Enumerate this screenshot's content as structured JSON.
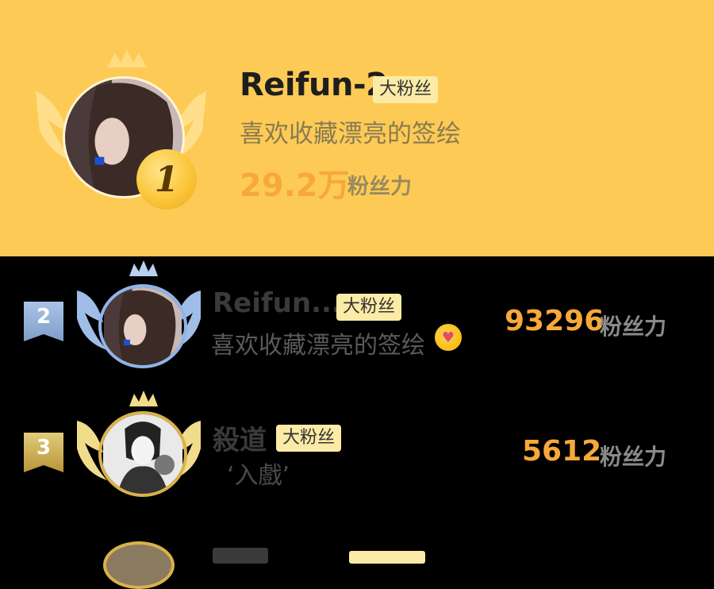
{
  "top_entry": {
    "rank": "1",
    "name": "Reifun-2",
    "badge": "大粉丝",
    "bio": "喜欢收藏漂亮的签绘",
    "score": "29.2万",
    "score_label": "粉丝力"
  },
  "entries": [
    {
      "rank": "2",
      "name": "Reifun...",
      "badge": "大粉丝",
      "bio": "喜欢收藏漂亮的签绘",
      "bio_emoji_icon": "hugging-face-icon",
      "score": "93296",
      "score_label": "粉丝力"
    },
    {
      "rank": "3",
      "name": "殺道",
      "badge": "大粉丝",
      "bio": "‘入戲’",
      "score": "5612",
      "score_label": "粉丝力"
    }
  ],
  "colors": {
    "top_background": "#FDCB55",
    "list_background": "#000000",
    "score": "#F7A83A",
    "badge_background": "#FCEBA6",
    "rank2_silver": "#9DB8DE",
    "rank3_gold": "#D4B45A"
  }
}
